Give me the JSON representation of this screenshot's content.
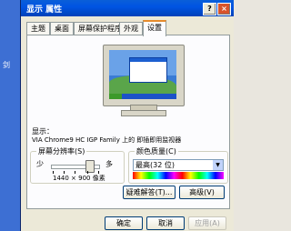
{
  "window": {
    "title": "显示 属性",
    "help_label": "?",
    "close_label": "×"
  },
  "desktop": {
    "side_label": "剑"
  },
  "tabs": [
    {
      "label": "主题"
    },
    {
      "label": "桌面"
    },
    {
      "label": "屏幕保护程序"
    },
    {
      "label": "外观"
    },
    {
      "label": "设置"
    }
  ],
  "display": {
    "label": "显示：",
    "device": "VIA Chrome9 HC IGP Family 上的 即插即用监视器"
  },
  "resolution": {
    "title": "屏幕分辨率(S)",
    "less": "少",
    "more": "多",
    "value": "1440 × 900 像素",
    "slider_level": 0.85
  },
  "color_quality": {
    "title": "颜色质量(C)",
    "selected": "最高(32 位)"
  },
  "buttons": {
    "troubleshoot": "疑难解答(T)...",
    "advanced": "高级(V)",
    "ok": "确定",
    "cancel": "取消",
    "apply": "应用(A)"
  }
}
